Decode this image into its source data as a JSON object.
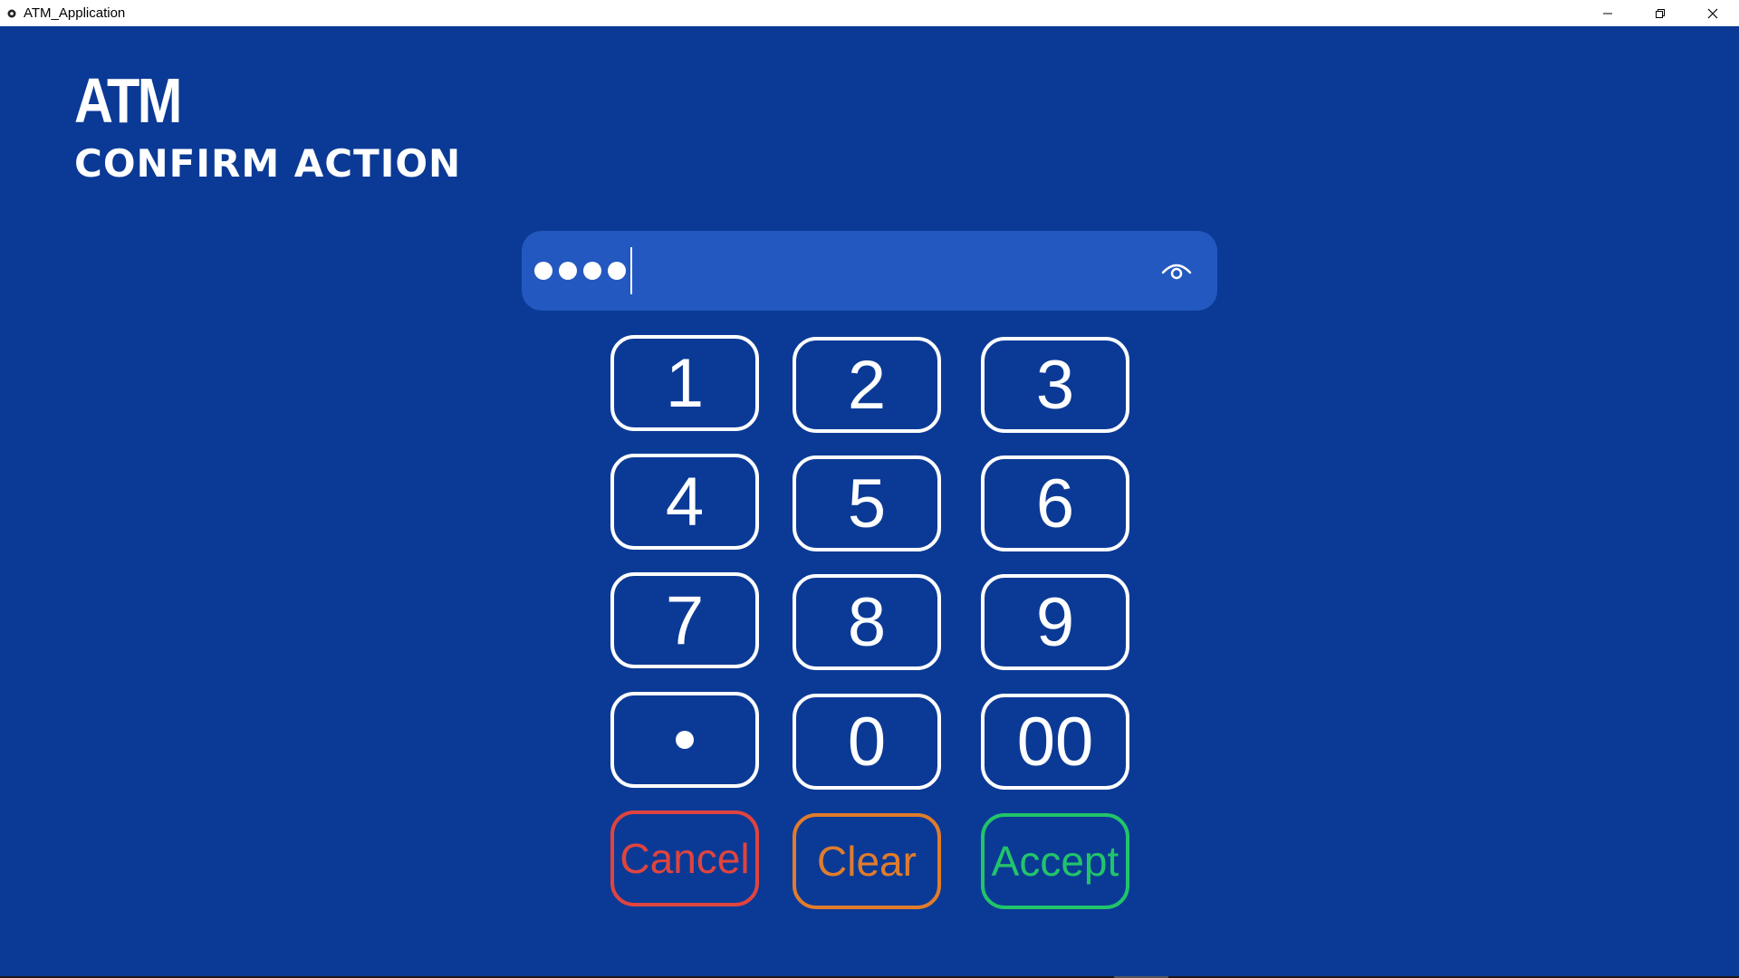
{
  "window": {
    "title": "ATM_Application",
    "icon": "app-gear-icon",
    "controls": [
      "minimize-icon",
      "restore-icon",
      "close-icon"
    ]
  },
  "screen": {
    "title": "ATM",
    "subtitle": "CONFIRM ACTION"
  },
  "pin_field": {
    "masked_length": 4,
    "visibility_icon": "eye-icon"
  },
  "keypad": {
    "keys": [
      "1",
      "2",
      "3",
      "4",
      "5",
      "6",
      "7",
      "8",
      "9",
      "•",
      "0",
      "00"
    ]
  },
  "actions": {
    "cancel_label": "Cancel",
    "clear_label": "Clear",
    "accept_label": "Accept"
  },
  "colors": {
    "background": "#0b3a96",
    "field": "#2358c0",
    "cancel": "#e0443f",
    "clear": "#e07c2c",
    "accept": "#22c46a"
  }
}
